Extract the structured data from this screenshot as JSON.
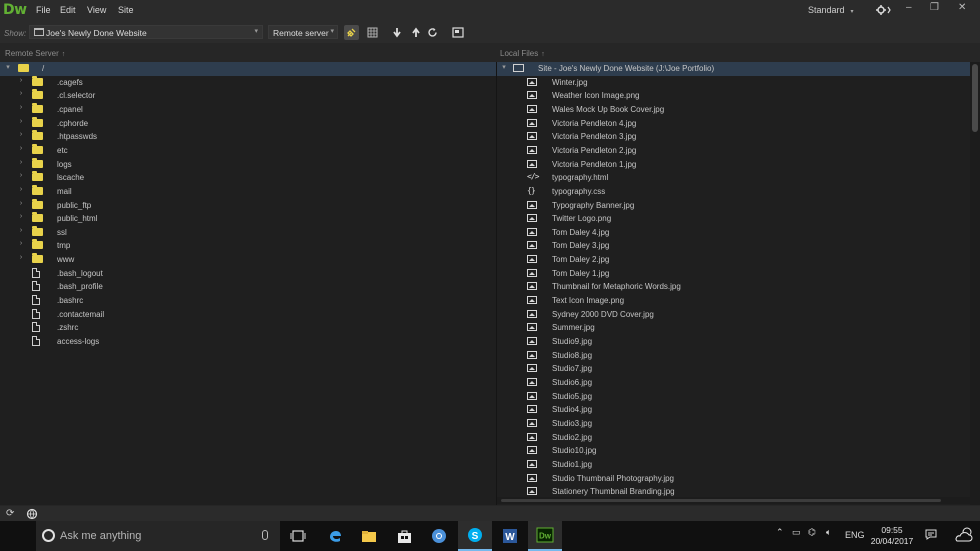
{
  "app": {
    "logo": "Dw"
  },
  "menu": {
    "file": "File",
    "edit": "Edit",
    "view": "View",
    "site": "Site"
  },
  "workspace": {
    "label": "Standard",
    "caret": "▾"
  },
  "toolbar": {
    "show_label": "Show:",
    "site_value": "Joe's Newly Done Website",
    "server_value": "Remote server",
    "caret": "▾"
  },
  "remote_panel": {
    "header": "Remote Server",
    "sort_arrow": "↑",
    "root": "/",
    "items": [
      {
        "name": ".cagefs",
        "type": "folder"
      },
      {
        "name": ".cl.selector",
        "type": "folder"
      },
      {
        "name": ".cpanel",
        "type": "folder"
      },
      {
        "name": ".cphorde",
        "type": "folder"
      },
      {
        "name": ".htpasswds",
        "type": "folder"
      },
      {
        "name": "etc",
        "type": "folder"
      },
      {
        "name": "logs",
        "type": "folder"
      },
      {
        "name": "lscache",
        "type": "folder"
      },
      {
        "name": "mail",
        "type": "folder"
      },
      {
        "name": "public_ftp",
        "type": "folder"
      },
      {
        "name": "public_html",
        "type": "folder"
      },
      {
        "name": "ssl",
        "type": "folder"
      },
      {
        "name": "tmp",
        "type": "folder"
      },
      {
        "name": "www",
        "type": "folder"
      },
      {
        "name": ".bash_logout",
        "type": "file"
      },
      {
        "name": ".bash_profile",
        "type": "file"
      },
      {
        "name": ".bashrc",
        "type": "file"
      },
      {
        "name": ".contactemail",
        "type": "file"
      },
      {
        "name": ".zshrc",
        "type": "file"
      },
      {
        "name": "access-logs",
        "type": "file"
      }
    ]
  },
  "local_panel": {
    "header": "Local Files",
    "sort_arrow": "↑",
    "root": "Site - Joe's Newly Done Website (J:\\Joe Portfolio)",
    "items": [
      {
        "name": "Winter.jpg",
        "type": "image"
      },
      {
        "name": "Weather Icon Image.png",
        "type": "image"
      },
      {
        "name": "Wales Mock Up Book Cover.jpg",
        "type": "image"
      },
      {
        "name": "Victoria Pendleton 4.jpg",
        "type": "image"
      },
      {
        "name": "Victoria Pendleton 3.jpg",
        "type": "image"
      },
      {
        "name": "Victoria Pendleton 2.jpg",
        "type": "image"
      },
      {
        "name": "Victoria Pendleton 1.jpg",
        "type": "image"
      },
      {
        "name": "typography.html",
        "type": "html"
      },
      {
        "name": "typography.css",
        "type": "css"
      },
      {
        "name": "Typography Banner.jpg",
        "type": "image"
      },
      {
        "name": "Twitter Logo.png",
        "type": "image"
      },
      {
        "name": "Tom Daley 4.jpg",
        "type": "image"
      },
      {
        "name": "Tom Daley 3.jpg",
        "type": "image"
      },
      {
        "name": "Tom Daley 2.jpg",
        "type": "image"
      },
      {
        "name": "Tom Daley 1.jpg",
        "type": "image"
      },
      {
        "name": "Thumbnail for Metaphoric Words.jpg",
        "type": "image"
      },
      {
        "name": "Text Icon Image.png",
        "type": "image"
      },
      {
        "name": "Sydney 2000 DVD Cover.jpg",
        "type": "image"
      },
      {
        "name": "Summer.jpg",
        "type": "image"
      },
      {
        "name": "Studio9.jpg",
        "type": "image"
      },
      {
        "name": "Studio8.jpg",
        "type": "image"
      },
      {
        "name": "Studio7.jpg",
        "type": "image"
      },
      {
        "name": "Studio6.jpg",
        "type": "image"
      },
      {
        "name": "Studio5.jpg",
        "type": "image"
      },
      {
        "name": "Studio4.jpg",
        "type": "image"
      },
      {
        "name": "Studio3.jpg",
        "type": "image"
      },
      {
        "name": "Studio2.jpg",
        "type": "image"
      },
      {
        "name": "Studio10.jpg",
        "type": "image"
      },
      {
        "name": "Studio1.jpg",
        "type": "image"
      },
      {
        "name": "Studio Thumbnail Photography.jpg",
        "type": "image"
      },
      {
        "name": "Stationery Thumbnail Branding.jpg",
        "type": "image"
      }
    ]
  },
  "taskbar": {
    "search_placeholder": "Ask me anything",
    "language": "ENG",
    "time": "09:55",
    "date": "20/04/2017"
  },
  "colors": {
    "accent_dw": "#62b034",
    "folder": "#e8d24a",
    "selection": "#2e3d4e",
    "panel_bg": "#1f1f1f",
    "chrome_bg": "#2b2b2b"
  }
}
